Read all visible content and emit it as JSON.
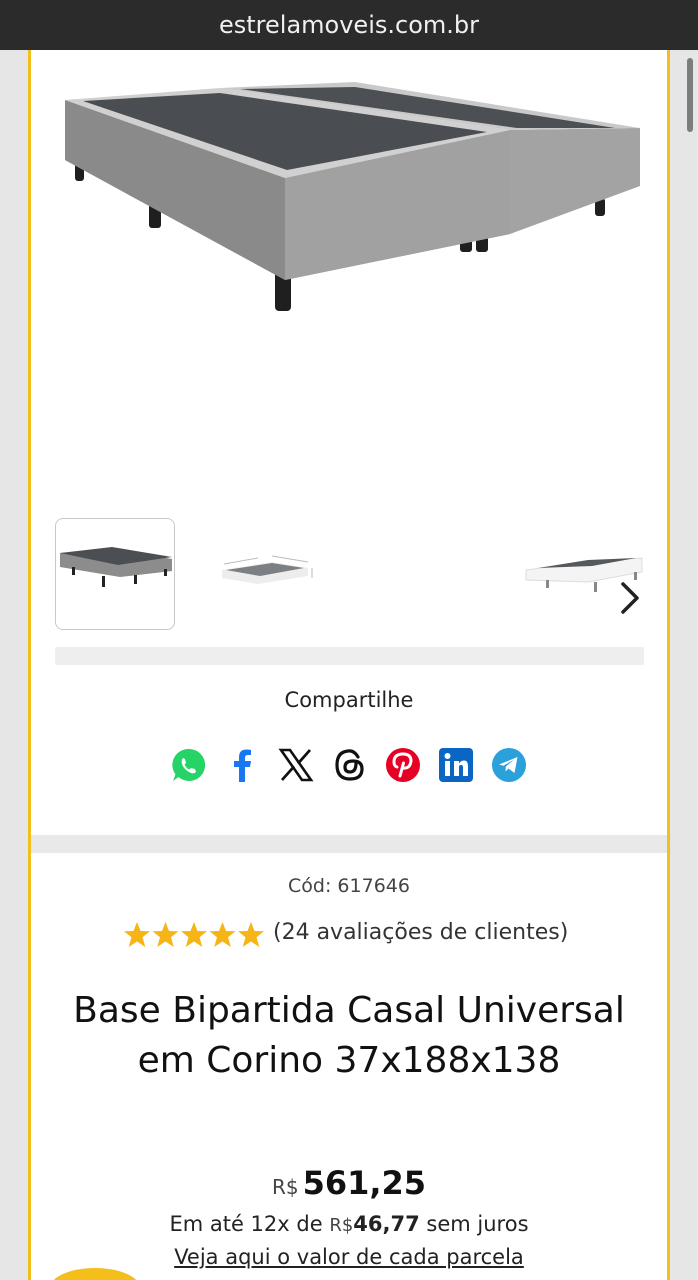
{
  "browser": {
    "url": "estrelamoveis.com.br"
  },
  "gallery": {
    "thumbnails": [
      {
        "name": "thumbnail-1",
        "selected": true
      },
      {
        "name": "thumbnail-2",
        "selected": false
      },
      {
        "name": "thumbnail-3",
        "selected": false
      },
      {
        "name": "thumbnail-4",
        "selected": false
      }
    ],
    "next_icon": "chevron-right-icon"
  },
  "share": {
    "title": "Compartilhe",
    "networks": [
      "whatsapp",
      "facebook",
      "x",
      "threads",
      "pinterest",
      "linkedin",
      "telegram"
    ]
  },
  "product": {
    "code": "Cód: 617646",
    "rating": 5,
    "reviews": "(24 avaliações de clientes)",
    "title_line1": "Base Bipartida Casal Universal",
    "title_line2": "em Corino 37x188x138",
    "price_currency": "R$",
    "price_value": "561,25",
    "installment_prefix": "Em até 12x de",
    "installment_currency": "R$",
    "installment_value": "46,77",
    "installment_suffix": "sem juros",
    "installments_link": "Veja aqui o valor de cada parcela"
  },
  "colors": {
    "accent": "#f4bf1a",
    "star": "#f5b516",
    "whatsapp": "#25d366",
    "facebook": "#1877f2",
    "pinterest": "#e60023",
    "linkedin": "#0a66c2",
    "telegram": "#2aa1da"
  }
}
